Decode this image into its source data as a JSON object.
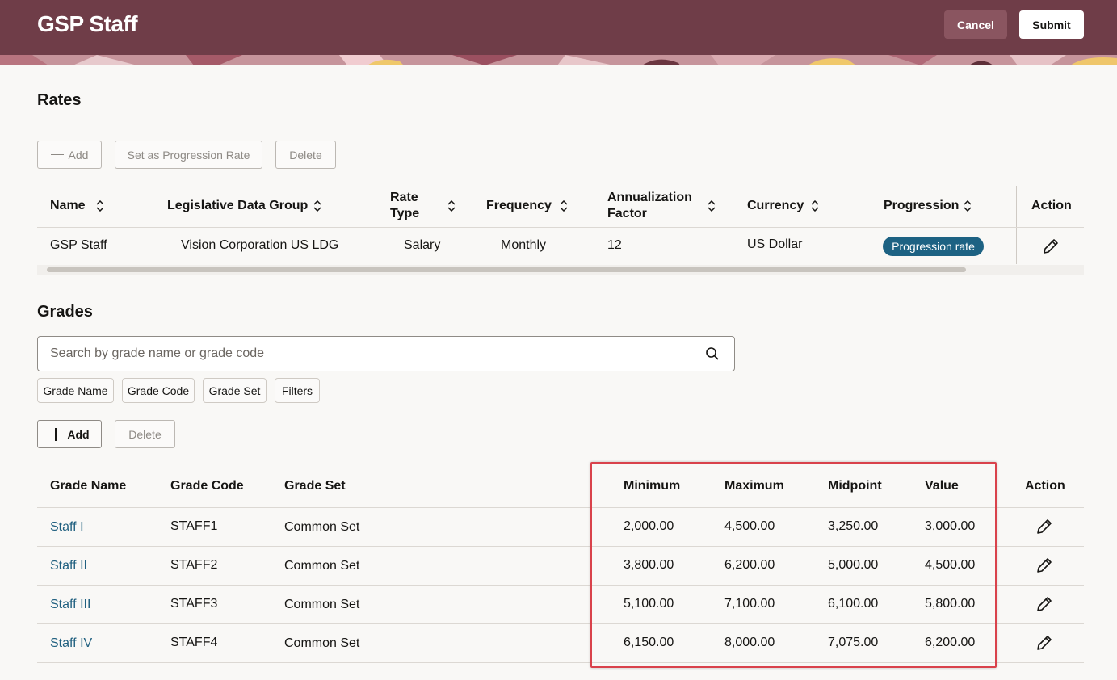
{
  "header": {
    "title": "GSP Staff",
    "cancel_label": "Cancel",
    "submit_label": "Submit"
  },
  "rates": {
    "title": "Rates",
    "toolbar": {
      "add_label": "Add",
      "set_progression_label": "Set as Progression Rate",
      "delete_label": "Delete"
    },
    "columns": {
      "name": "Name",
      "ldg": "Legislative Data Group",
      "rate_type_1": "Rate",
      "rate_type_2": "Type",
      "frequency": "Frequency",
      "annualization_1": "Annualization",
      "annualization_2": "Factor",
      "currency": "Currency",
      "progression": "Progression",
      "action": "Action"
    },
    "row": {
      "name": "GSP Staff",
      "ldg": "Vision Corporation US LDG",
      "rate_type": "Salary",
      "frequency": "Monthly",
      "annualization": "12",
      "currency": "US Dollar",
      "progression": "Progression rate"
    }
  },
  "grades": {
    "title": "Grades",
    "search_placeholder": "Search by grade name or grade code",
    "chips": [
      "Grade Name",
      "Grade Code",
      "Grade Set",
      "Filters"
    ],
    "toolbar": {
      "add_label": "Add",
      "delete_label": "Delete"
    },
    "columns": {
      "grade_name": "Grade Name",
      "grade_code": "Grade Code",
      "grade_set": "Grade Set",
      "minimum": "Minimum",
      "maximum": "Maximum",
      "midpoint": "Midpoint",
      "value": "Value",
      "action": "Action"
    },
    "rows": [
      {
        "name": "Staff I",
        "code": "STAFF1",
        "set": "Common Set",
        "min": "2,000.00",
        "max": "4,500.00",
        "mid": "3,250.00",
        "value": "3,000.00"
      },
      {
        "name": "Staff II",
        "code": "STAFF2",
        "set": "Common Set",
        "min": "3,800.00",
        "max": "6,200.00",
        "mid": "5,000.00",
        "value": "4,500.00"
      },
      {
        "name": "Staff III",
        "code": "STAFF3",
        "set": "Common Set",
        "min": "5,100.00",
        "max": "7,100.00",
        "mid": "6,100.00",
        "value": "5,800.00"
      },
      {
        "name": "Staff IV",
        "code": "STAFF4",
        "set": "Common Set",
        "min": "6,150.00",
        "max": "8,000.00",
        "mid": "7,075.00",
        "value": "6,200.00"
      }
    ]
  },
  "colors": {
    "header_bg": "#6f3d48",
    "link": "#1f5f7f",
    "badge": "#1d6283",
    "highlight": "#d9424b"
  }
}
